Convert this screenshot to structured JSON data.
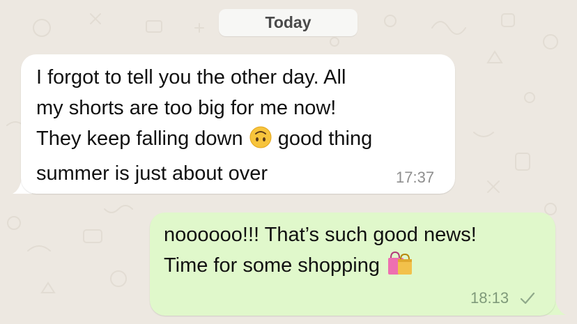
{
  "chat": {
    "date_label": "Today",
    "messages": [
      {
        "direction": "incoming",
        "line1": "I forgot to tell you the other day. All",
        "line2": "my shorts are too big for me now!",
        "line3_before_emoji": "They keep falling down ",
        "line3_after_emoji": " good thing",
        "line4": "summer is just about over",
        "emoji": "upside-down-face-emoji",
        "time": "17:37"
      },
      {
        "direction": "outgoing",
        "line1": "noooooo!!! That’s such good news!",
        "line2_before_emoji": "Time for some shopping ",
        "emoji": "shopping-bags-emoji",
        "time": "18:13",
        "status": "sent-check-icon"
      }
    ]
  },
  "colors": {
    "background": "#ede8e1",
    "incoming_bubble": "#ffffff",
    "outgoing_bubble": "#e0f8cb",
    "date_pill": "#f7f7f5"
  }
}
